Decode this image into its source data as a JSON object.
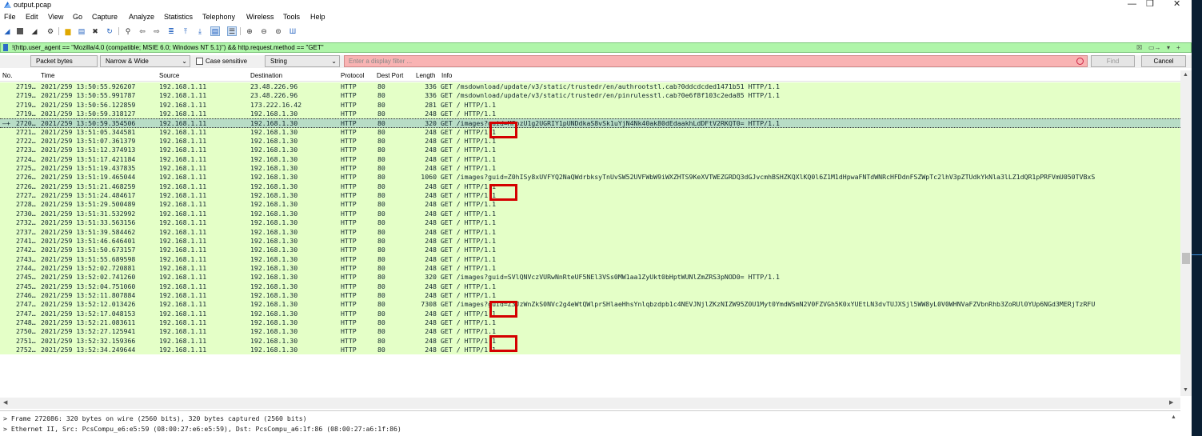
{
  "window": {
    "title": "output.pcap",
    "minimize": "—",
    "restore": "❐",
    "close": "✕"
  },
  "menu": [
    "File",
    "Edit",
    "View",
    "Go",
    "Capture",
    "Analyze",
    "Statistics",
    "Telephony",
    "Wireless",
    "Tools",
    "Help"
  ],
  "display_filter": {
    "expression": "!(http.user_agent == \"Mozilla/4.0 (compatible; MSIE 6.0; Windows NT 5.1)\") && http.request.method == \"GET\"",
    "bg_color": "#aff5a9"
  },
  "find_bar": {
    "search_in": "Packet bytes",
    "char_width": "Narrow & Wide",
    "case_sensitive_label": "Case sensitive",
    "search_type": "String",
    "placeholder": "Enter a display filter ...",
    "find_label": "Find",
    "cancel_label": "Cancel"
  },
  "columns": [
    "No.",
    "Time",
    "Source",
    "Destination",
    "Protocol",
    "Dest Port",
    "Length",
    "Info"
  ],
  "packets": [
    {
      "no": "2719…",
      "time": "2021/259 13:50:55.926207",
      "src": "192.168.1.11",
      "dst": "23.48.226.96",
      "proto": "HTTP",
      "port": "80",
      "len": "336",
      "info": "GET /msdownload/update/v3/static/trustedr/en/authrootstl.cab?0ddcdcded1471b51 HTTP/1.1"
    },
    {
      "no": "2719…",
      "time": "2021/259 13:50:55.991787",
      "src": "192.168.1.11",
      "dst": "23.48.226.96",
      "proto": "HTTP",
      "port": "80",
      "len": "336",
      "info": "GET /msdownload/update/v3/static/trustedr/en/pinrulesstl.cab?0e6f8f103c2eda85 HTTP/1.1"
    },
    {
      "no": "2719…",
      "time": "2021/259 13:50:56.122859",
      "src": "192.168.1.11",
      "dst": "173.222.16.42",
      "proto": "HTTP",
      "port": "80",
      "len": "281",
      "info": "GET / HTTP/1.1"
    },
    {
      "no": "2719…",
      "time": "2021/259 13:50:59.318127",
      "src": "192.168.1.11",
      "dst": "192.168.1.30",
      "proto": "HTTP",
      "port": "80",
      "len": "248",
      "info": "GET / HTTP/1.1"
    },
    {
      "no": "2720…",
      "time": "2021/259 13:50:59.354506",
      "src": "192.168.1.11",
      "dst": "192.168.1.30",
      "proto": "HTTP",
      "port": "80",
      "len": "320",
      "info": "GET /images?guid=MFozU1g2UGRIY1pUNDdkaS8vSk1uYjN4Nk40ak80dEdaakhLdDFtV2RKQT0= HTTP/1.1",
      "selected": true
    },
    {
      "no": "2721…",
      "time": "2021/259 13:51:05.344581",
      "src": "192.168.1.11",
      "dst": "192.168.1.30",
      "proto": "HTTP",
      "port": "80",
      "len": "248",
      "info": "GET / HTTP/1.1"
    },
    {
      "no": "2722…",
      "time": "2021/259 13:51:07.361379",
      "src": "192.168.1.11",
      "dst": "192.168.1.30",
      "proto": "HTTP",
      "port": "80",
      "len": "248",
      "info": "GET / HTTP/1.1"
    },
    {
      "no": "2723…",
      "time": "2021/259 13:51:12.374913",
      "src": "192.168.1.11",
      "dst": "192.168.1.30",
      "proto": "HTTP",
      "port": "80",
      "len": "248",
      "info": "GET / HTTP/1.1"
    },
    {
      "no": "2724…",
      "time": "2021/259 13:51:17.421184",
      "src": "192.168.1.11",
      "dst": "192.168.1.30",
      "proto": "HTTP",
      "port": "80",
      "len": "248",
      "info": "GET / HTTP/1.1"
    },
    {
      "no": "2725…",
      "time": "2021/259 13:51:19.437835",
      "src": "192.168.1.11",
      "dst": "192.168.1.30",
      "proto": "HTTP",
      "port": "80",
      "len": "248",
      "info": "GET / HTTP/1.1"
    },
    {
      "no": "2726…",
      "time": "2021/259 13:51:19.465044",
      "src": "192.168.1.11",
      "dst": "192.168.1.30",
      "proto": "HTTP",
      "port": "80",
      "len": "1060",
      "info": "GET /images?guid=Z0hISy8xUVFYQ2NaQWdrbksyTnUvSW52UVFWbW9iWXZHTS9KeXVTWEZGRDQ3dGJvcmhBSHZKQXlKQ0l6Z1M1dHpwaFNTdWNRcHFDdnFSZWpTc2lhV3pZTUdkYkNla3lLZ1dQR1pPRFVmU050TVBxS"
    },
    {
      "no": "2726…",
      "time": "2021/259 13:51:21.468259",
      "src": "192.168.1.11",
      "dst": "192.168.1.30",
      "proto": "HTTP",
      "port": "80",
      "len": "248",
      "info": "GET / HTTP/1.1"
    },
    {
      "no": "2727…",
      "time": "2021/259 13:51:24.484617",
      "src": "192.168.1.11",
      "dst": "192.168.1.30",
      "proto": "HTTP",
      "port": "80",
      "len": "248",
      "info": "GET / HTTP/1.1"
    },
    {
      "no": "2728…",
      "time": "2021/259 13:51:29.500489",
      "src": "192.168.1.11",
      "dst": "192.168.1.30",
      "proto": "HTTP",
      "port": "80",
      "len": "248",
      "info": "GET / HTTP/1.1"
    },
    {
      "no": "2730…",
      "time": "2021/259 13:51:31.532992",
      "src": "192.168.1.11",
      "dst": "192.168.1.30",
      "proto": "HTTP",
      "port": "80",
      "len": "248",
      "info": "GET / HTTP/1.1"
    },
    {
      "no": "2732…",
      "time": "2021/259 13:51:33.563156",
      "src": "192.168.1.11",
      "dst": "192.168.1.30",
      "proto": "HTTP",
      "port": "80",
      "len": "248",
      "info": "GET / HTTP/1.1"
    },
    {
      "no": "2737…",
      "time": "2021/259 13:51:39.584462",
      "src": "192.168.1.11",
      "dst": "192.168.1.30",
      "proto": "HTTP",
      "port": "80",
      "len": "248",
      "info": "GET / HTTP/1.1"
    },
    {
      "no": "2741…",
      "time": "2021/259 13:51:46.646401",
      "src": "192.168.1.11",
      "dst": "192.168.1.30",
      "proto": "HTTP",
      "port": "80",
      "len": "248",
      "info": "GET / HTTP/1.1"
    },
    {
      "no": "2742…",
      "time": "2021/259 13:51:50.673157",
      "src": "192.168.1.11",
      "dst": "192.168.1.30",
      "proto": "HTTP",
      "port": "80",
      "len": "248",
      "info": "GET / HTTP/1.1"
    },
    {
      "no": "2743…",
      "time": "2021/259 13:51:55.689598",
      "src": "192.168.1.11",
      "dst": "192.168.1.30",
      "proto": "HTTP",
      "port": "80",
      "len": "248",
      "info": "GET / HTTP/1.1"
    },
    {
      "no": "2744…",
      "time": "2021/259 13:52:02.720881",
      "src": "192.168.1.11",
      "dst": "192.168.1.30",
      "proto": "HTTP",
      "port": "80",
      "len": "248",
      "info": "GET / HTTP/1.1"
    },
    {
      "no": "2745…",
      "time": "2021/259 13:52:02.741260",
      "src": "192.168.1.11",
      "dst": "192.168.1.30",
      "proto": "HTTP",
      "port": "80",
      "len": "320",
      "info": "GET /images?guid=SVlQNVczVURwNnRteUF5NEl3VSs0MW1aa1ZyUkt0bHptWUNlZmZRS3pNOD0= HTTP/1.1"
    },
    {
      "no": "2745…",
      "time": "2021/259 13:52:04.751060",
      "src": "192.168.1.11",
      "dst": "192.168.1.30",
      "proto": "HTTP",
      "port": "80",
      "len": "248",
      "info": "GET / HTTP/1.1"
    },
    {
      "no": "2746…",
      "time": "2021/259 13:52:11.807884",
      "src": "192.168.1.11",
      "dst": "192.168.1.30",
      "proto": "HTTP",
      "port": "80",
      "len": "248",
      "info": "GET / HTTP/1.1"
    },
    {
      "no": "2747…",
      "time": "2021/259 13:52:12.013426",
      "src": "192.168.1.11",
      "dst": "192.168.1.30",
      "proto": "HTTP",
      "port": "80",
      "len": "7308",
      "info": "GET /images?guid=Z3JzWnZkS0NVc2g4eWtQWlprSHlaeHhsYnlqbzdpb1c4NEVJNjlZKzNIZW95Z0U1Myt0YmdWSmN2V0FZVGh5K0xYUEtLN3dvTUJXSjl5WW8yL0V0WHNVaFZVbnRhb3ZoRUl0YUp6NGd3MERjTzRFU"
    },
    {
      "no": "2747…",
      "time": "2021/259 13:52:17.048153",
      "src": "192.168.1.11",
      "dst": "192.168.1.30",
      "proto": "HTTP",
      "port": "80",
      "len": "248",
      "info": "GET / HTTP/1.1"
    },
    {
      "no": "2748…",
      "time": "2021/259 13:52:21.083611",
      "src": "192.168.1.11",
      "dst": "192.168.1.30",
      "proto": "HTTP",
      "port": "80",
      "len": "248",
      "info": "GET / HTTP/1.1"
    },
    {
      "no": "2750…",
      "time": "2021/259 13:52:27.125941",
      "src": "192.168.1.11",
      "dst": "192.168.1.30",
      "proto": "HTTP",
      "port": "80",
      "len": "248",
      "info": "GET / HTTP/1.1"
    },
    {
      "no": "2751…",
      "time": "2021/259 13:52:32.159366",
      "src": "192.168.1.11",
      "dst": "192.168.1.30",
      "proto": "HTTP",
      "port": "80",
      "len": "248",
      "info": "GET / HTTP/1.1"
    },
    {
      "no": "2752…",
      "time": "2021/259 13:52:34.249644",
      "src": "192.168.1.11",
      "dst": "192.168.1.30",
      "proto": "HTTP",
      "port": "80",
      "len": "248",
      "info": "GET / HTTP/1.1"
    }
  ],
  "details": {
    "frame": "Frame 272086: 320 bytes on wire (2560 bits), 320 bytes captured (2560 bits)",
    "ethernet": "Ethernet II, Src: PcsCompu_e6:e5:59 (08:00:27:e6:e5:59), Dst: PcsCompu_a6:1f:86 (08:00:27:a6:1f:86)"
  },
  "colors": {
    "row_bg": "#e4ffc7",
    "selected_bg": "#b8ddc6",
    "highlight_box": "#d40000",
    "filter_ok": "#aff5a9",
    "find_invalid": "#f9b3b3"
  }
}
